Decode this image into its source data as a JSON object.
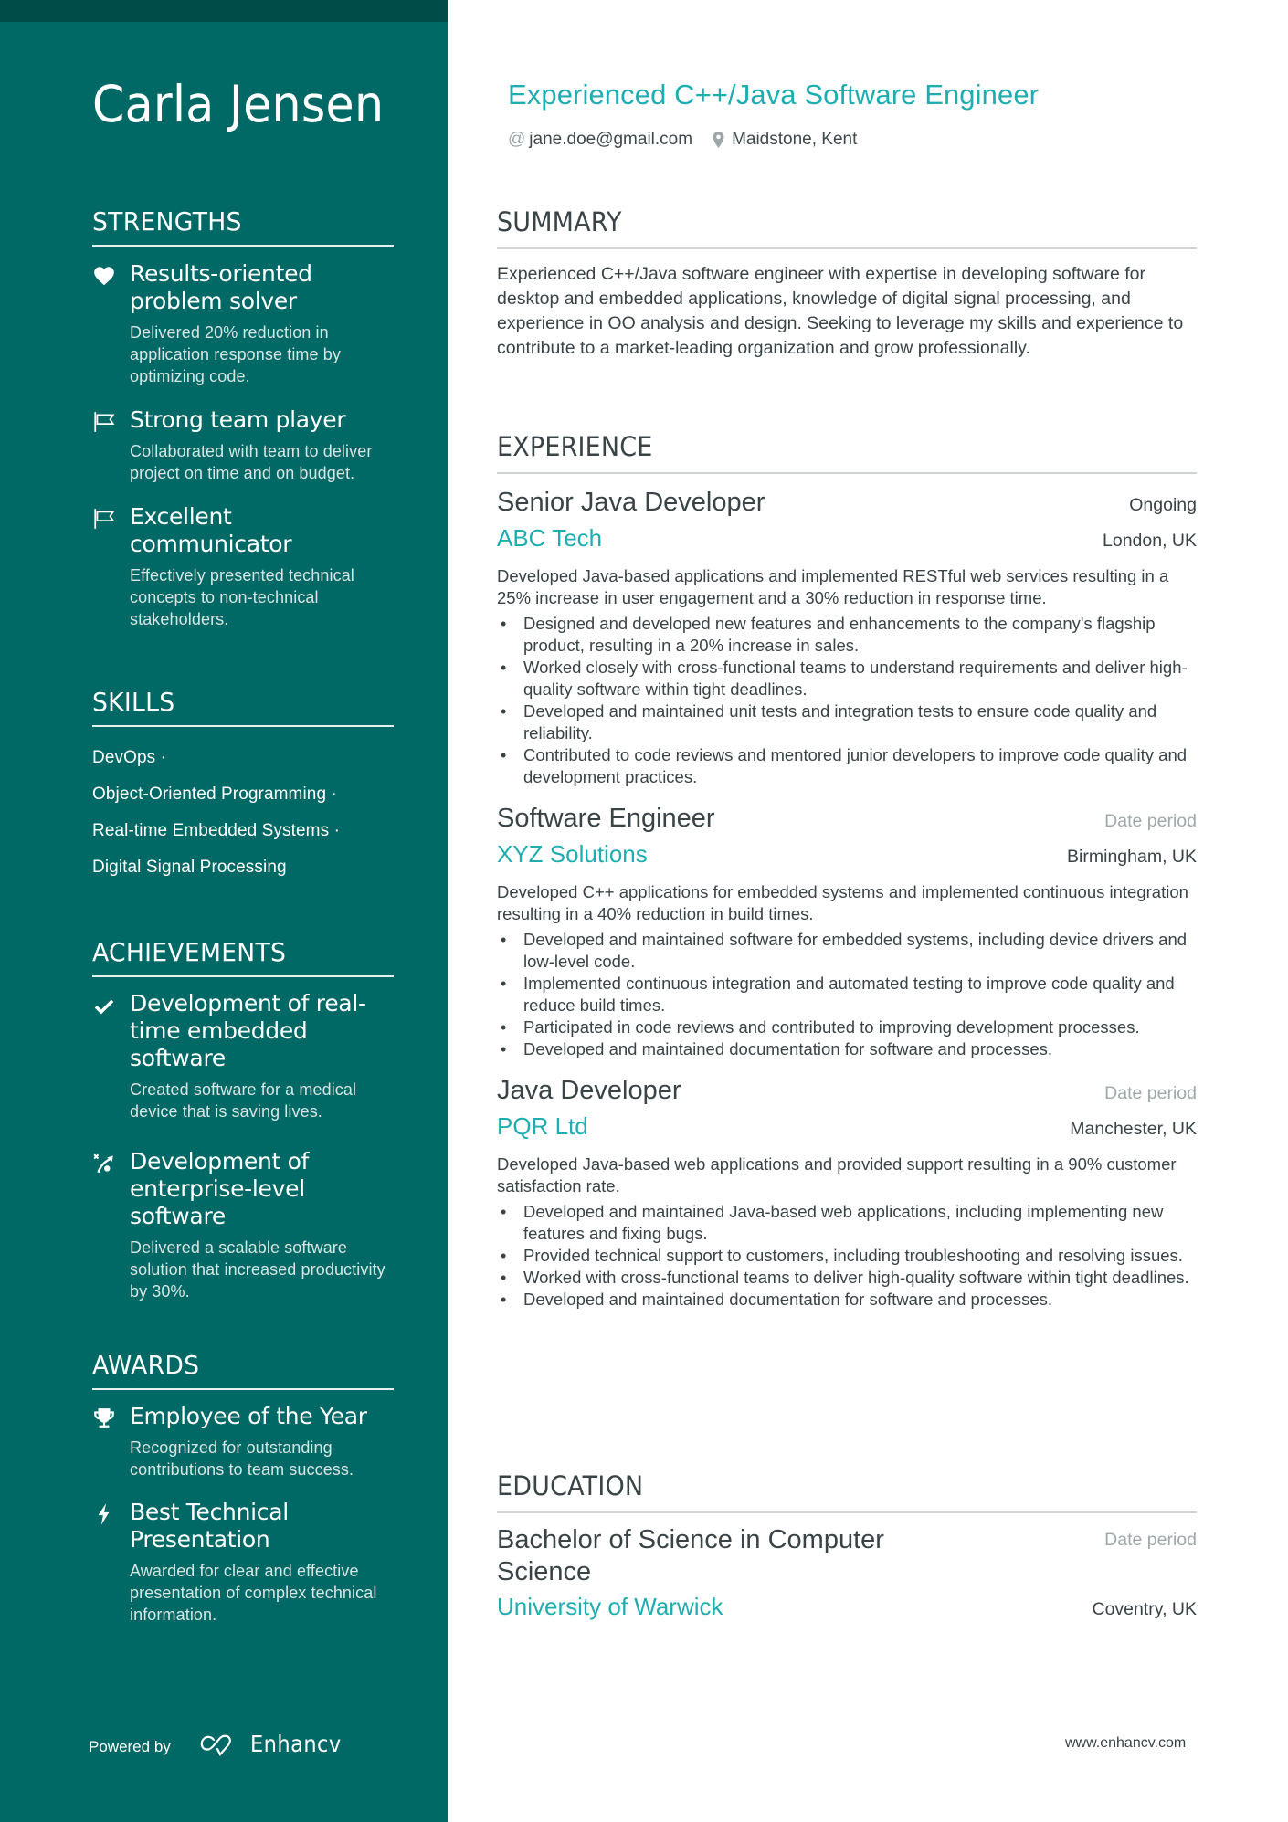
{
  "colors": {
    "sidebar_bg": "#006865",
    "sidebar_topbar": "#004c49",
    "accent": "#20adaf",
    "text": "#3a4346",
    "muted": "#a0a8aa"
  },
  "sidebar": {
    "name": "Carla Jensen",
    "strengths": {
      "title": "STRENGTHS",
      "items": [
        {
          "icon": "heart-icon",
          "title": "Results-oriented problem solver",
          "description": "Delivered 20% reduction in application response time by optimizing code."
        },
        {
          "icon": "flag-icon",
          "title": "Strong team player",
          "description": "Collaborated with team to deliver project on time and on budget."
        },
        {
          "icon": "flag-icon",
          "title": "Excellent communicator",
          "description": "Effectively presented technical concepts to non-technical stakeholders."
        }
      ]
    },
    "skills": {
      "title": "SKILLS",
      "items": [
        "DevOps ·",
        "Object-Oriented Programming ·",
        "Real-time Embedded Systems ·",
        "Digital Signal Processing"
      ]
    },
    "achievements": {
      "title": "ACHIEVEMENTS",
      "items": [
        {
          "icon": "checkmark-icon",
          "title": "Development of real-time embedded software",
          "description": "Created software for a medical device that is saving lives."
        },
        {
          "icon": "strategy-icon",
          "title": "Development of enterprise-level software",
          "description": "Delivered a scalable software solution that increased productivity by 30%."
        }
      ]
    },
    "awards": {
      "title": "AWARDS",
      "items": [
        {
          "icon": "trophy-icon",
          "title": "Employee of the Year",
          "description": "Recognized for outstanding contributions to team success."
        },
        {
          "icon": "lightning-icon",
          "title": "Best Technical Presentation",
          "description": "Awarded for clear and effective presentation of complex technical information."
        }
      ]
    },
    "footer": {
      "powered_by": "Powered by",
      "brand": "Enhancv"
    }
  },
  "header": {
    "job_title": "Experienced C++/Java Software Engineer",
    "email_icon": "@",
    "email": "jane.doe@gmail.com",
    "location": "Maidstone, Kent"
  },
  "summary": {
    "title": "SUMMARY",
    "text": "Experienced C++/Java software engineer with expertise in developing software for desktop and embedded applications, knowledge of digital signal processing, and experience in OO analysis and design. Seeking to leverage my skills and experience to contribute to a market-leading organization and grow professionally."
  },
  "experience": {
    "title": "EXPERIENCE",
    "entries": [
      {
        "role": "Senior Java Developer",
        "date": "Ongoing",
        "company": "ABC Tech",
        "location": "London, UK",
        "description": "Developed Java-based applications and implemented RESTful web services resulting in a 25% increase in user engagement and a 30% reduction in response time.",
        "bullets": [
          "Designed and developed new features and enhancements to the company's flagship product, resulting in a 20% increase in sales.",
          "Worked closely with cross-functional teams to understand requirements and deliver high-quality software within tight deadlines.",
          "Developed and maintained unit tests and integration tests to ensure code quality and reliability.",
          "Contributed to code reviews and mentored junior developers to improve code quality and development practices."
        ]
      },
      {
        "role": "Software Engineer",
        "date": "Date period",
        "company": "XYZ Solutions",
        "location": "Birmingham, UK",
        "description": "Developed C++ applications for embedded systems and implemented continuous integration resulting in a 40% reduction in build times.",
        "bullets": [
          "Developed and maintained software for embedded systems, including device drivers and low-level code.",
          "Implemented continuous integration and automated testing to improve code quality and reduce build times.",
          "Participated in code reviews and contributed to improving development processes.",
          "Developed and maintained documentation for software and processes."
        ]
      },
      {
        "role": "Java Developer",
        "date": "Date period",
        "company": "PQR Ltd",
        "location": "Manchester, UK",
        "description": "Developed Java-based web applications and provided support resulting in a 90% customer satisfaction rate.",
        "bullets": [
          "Developed and maintained Java-based web applications, including implementing new features and fixing bugs.",
          "Provided technical support to customers, including troubleshooting and resolving issues.",
          "Worked with cross-functional teams to deliver high-quality software within tight deadlines.",
          "Developed and maintained documentation for software and processes."
        ]
      }
    ]
  },
  "education": {
    "title": "EDUCATION",
    "entries": [
      {
        "degree": "Bachelor of Science in Computer Science",
        "date": "Date period",
        "school": "University of Warwick",
        "location": "Coventry, UK"
      }
    ]
  },
  "footer": {
    "website": "www.enhancv.com"
  }
}
